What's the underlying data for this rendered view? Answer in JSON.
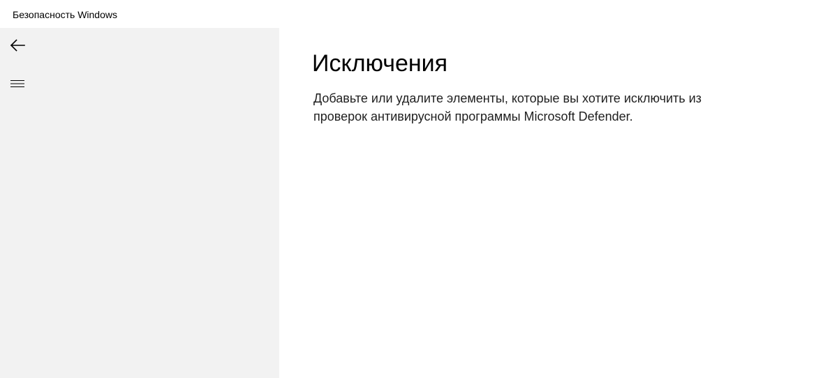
{
  "window": {
    "title": "Безопасность Windows"
  },
  "sidebar": {
    "back_icon": "back-arrow-icon",
    "menu_icon": "hamburger-menu-icon",
    "background": "#f2f2f2"
  },
  "main": {
    "title": "Исключения",
    "description": "Добавьте или удалите элементы, которые вы хотите исключить из проверок антивирусной программы Microsoft Defender."
  }
}
